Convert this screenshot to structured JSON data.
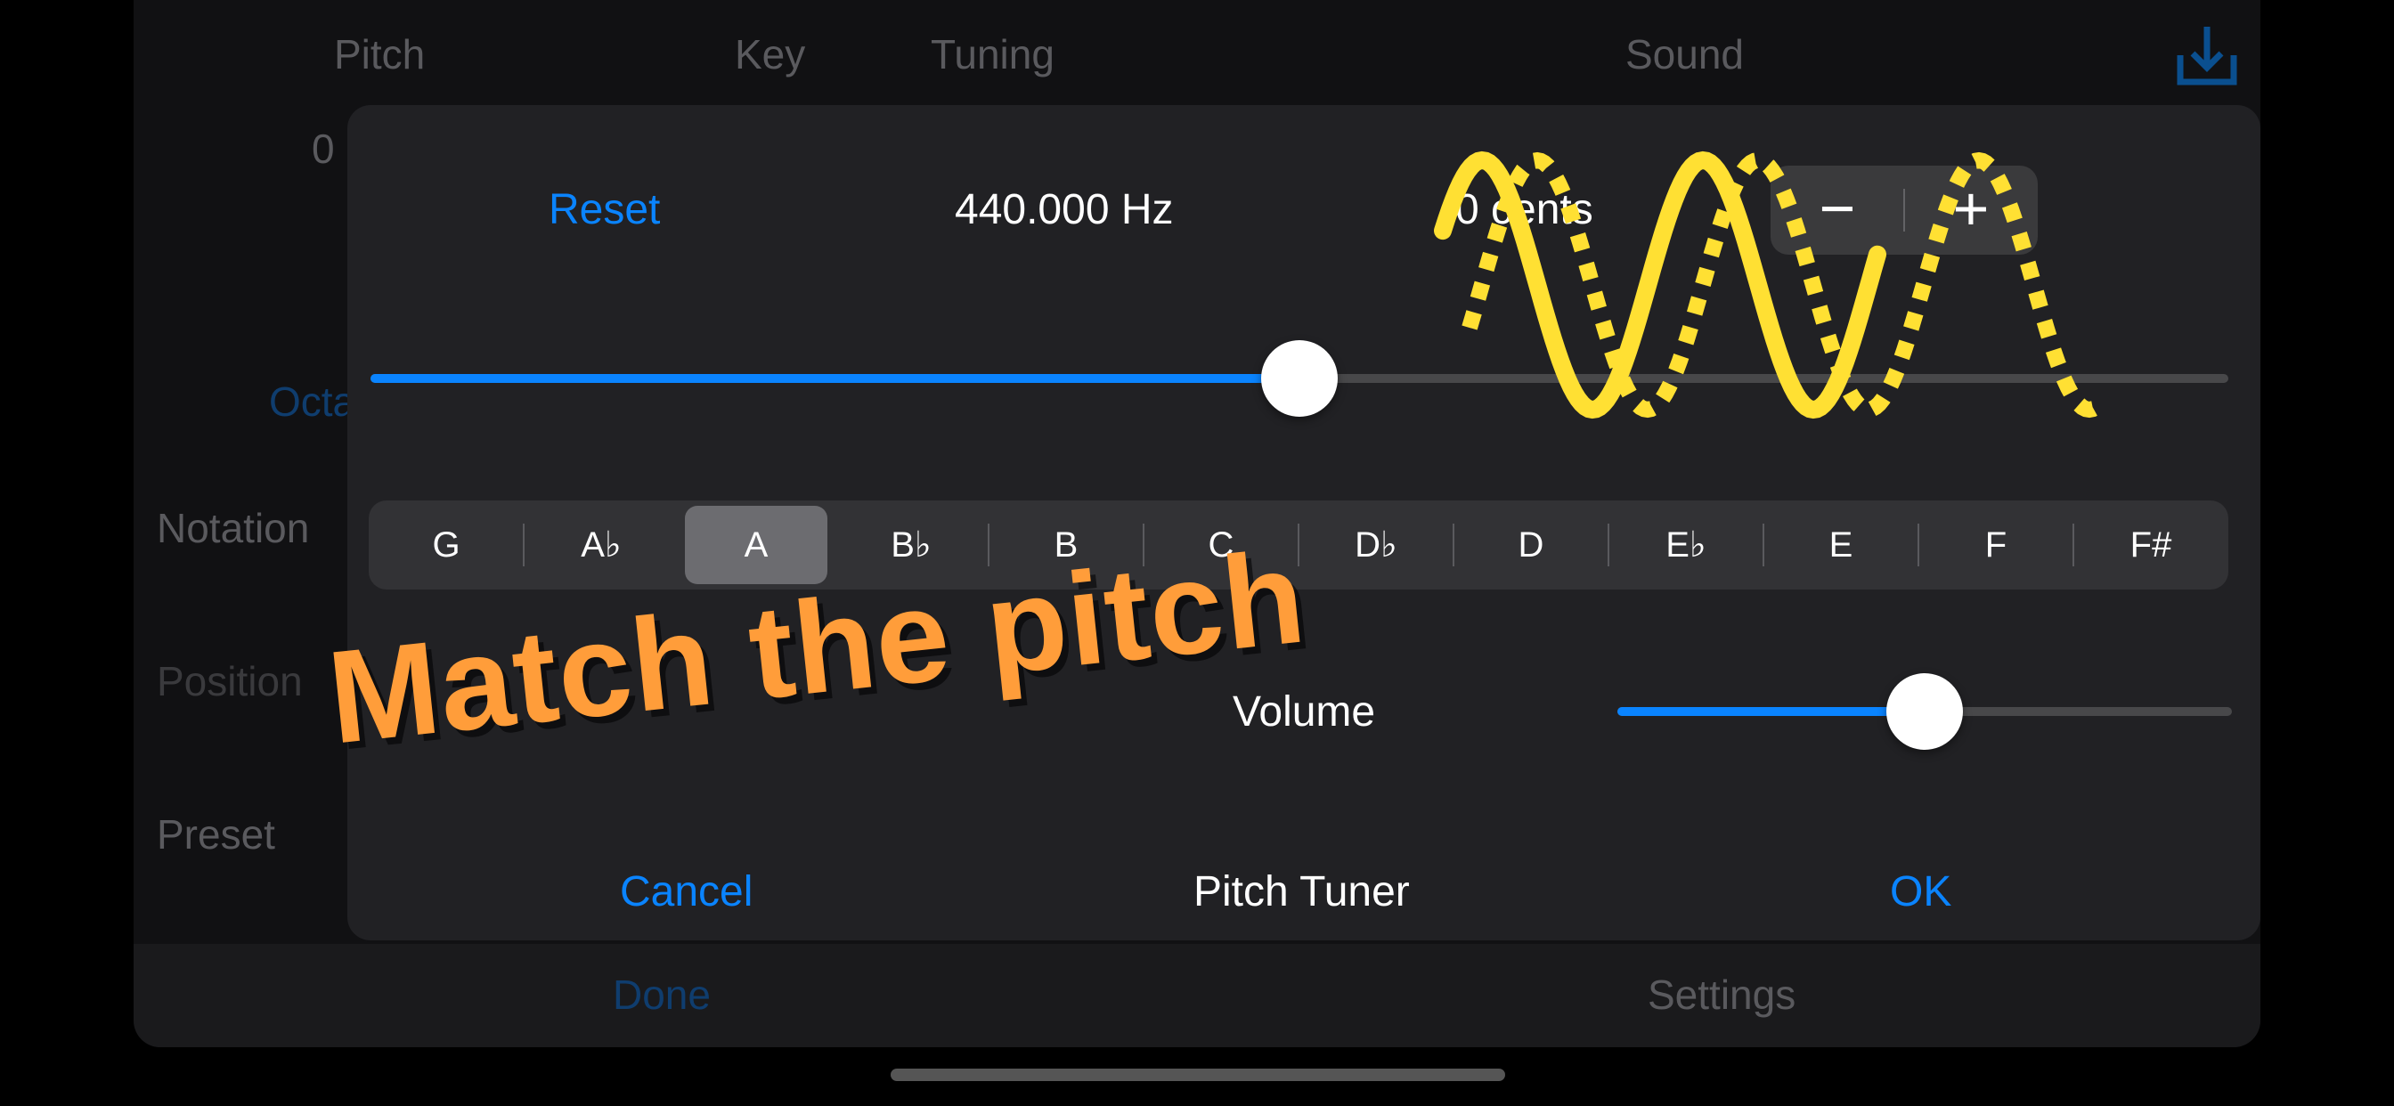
{
  "background": {
    "header_tabs": [
      "Pitch",
      "Key",
      "Tuning",
      "Sound"
    ],
    "pitch_value": "0",
    "octave_label": "Octa",
    "rows": [
      "Notation",
      "Position",
      "Preset"
    ],
    "bottom_bar": {
      "done": "Done",
      "settings": "Settings"
    },
    "export_icon": "export-icon"
  },
  "dialog": {
    "reset_label": "Reset",
    "frequency": "440.000 Hz",
    "cents": "0 cents",
    "stepper": {
      "minus": "−",
      "plus": "+"
    },
    "pitch_slider_value": 0.5,
    "notes": [
      "G",
      "A♭",
      "A",
      "B♭",
      "B",
      "C",
      "D♭",
      "D",
      "E♭",
      "E",
      "F",
      "F#"
    ],
    "selected_note": "A",
    "volume_label": "Volume",
    "volume_value": 0.5,
    "cancel_label": "Cancel",
    "title": "Pitch Tuner",
    "ok_label": "OK"
  },
  "overlay": {
    "banner": "Match the pitch",
    "banner_color": "#ff9d3a",
    "wave_color": "#ffe033"
  },
  "colors": {
    "accent": "#0a84ff",
    "dialog_bg": "#212124"
  }
}
